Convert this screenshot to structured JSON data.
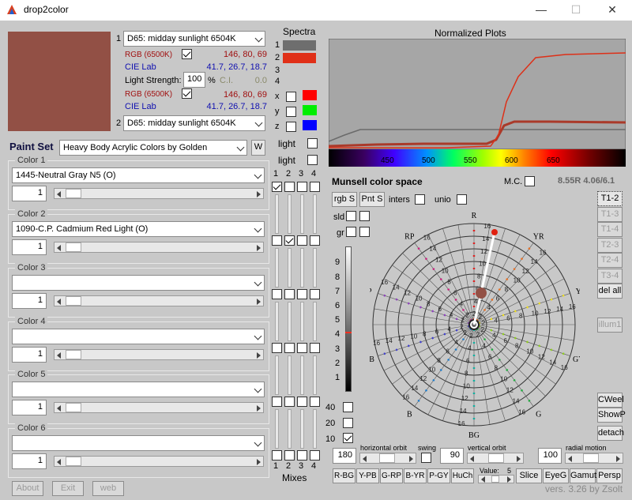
{
  "window": {
    "title": "drop2color"
  },
  "illum1": {
    "index": "1",
    "value": "D65: midday sunlight 6504K"
  },
  "illum2": {
    "index": "2",
    "value": "D65: midday sunlight 6504K"
  },
  "rgb1": {
    "label": "RGB (6500K)",
    "values": "146,   80,   69"
  },
  "lab1": {
    "label": "CIE Lab",
    "values": "41.7, 26.7, 18.7"
  },
  "light_strength": {
    "label": "Light Strength:",
    "value": "100",
    "unit": "%",
    "ci_label": "C.I.",
    "ci_value": "0.0"
  },
  "rgb2": {
    "label": "RGB (6500K)",
    "values": "146,   80,   69"
  },
  "lab2": {
    "label": "CIE Lab",
    "values": "41.7, 26.7, 18.7"
  },
  "swatch_color": "#925045",
  "paintset": {
    "label": "Paint Set",
    "value": "Heavy Body Acrylic Colors by Golden",
    "w_button": "W"
  },
  "colors": [
    {
      "label": "Color 1",
      "value": "1445-Neutral Gray N5 (O)",
      "qty": "1"
    },
    {
      "label": "Color 2",
      "value": "1090-C.P. Cadmium Red Light (O)",
      "qty": "1"
    },
    {
      "label": "Color 3",
      "value": "",
      "qty": "1"
    },
    {
      "label": "Color 4",
      "value": "",
      "qty": "1"
    },
    {
      "label": "Color 5",
      "value": "",
      "qty": "1"
    },
    {
      "label": "Color 6",
      "value": "",
      "qty": "1"
    }
  ],
  "mix_headers": [
    "1",
    "2",
    "3",
    "4"
  ],
  "mixes_label": "Mixes",
  "spectra": {
    "title": "Spectra",
    "rows": [
      "1",
      "2",
      "3",
      "4"
    ],
    "xyz": [
      "x",
      "y",
      "z"
    ],
    "light1": "light",
    "light2": "light",
    "row1_color": "#6e6e6e",
    "row2_color": "#e03018"
  },
  "plot": {
    "title": "Normalized Plots",
    "ticks": [
      "450",
      "500",
      "550",
      "600",
      "650"
    ]
  },
  "munsell": {
    "title": "Munsell color space",
    "mc_label": "M.C.",
    "readout": "8.55R 4.06/6.1",
    "rgbs": "rgb S",
    "pnts": "Pnt S",
    "inters": "inters",
    "unio": "unio",
    "sld": "sld",
    "gr": "gr",
    "dots": [
      "40",
      "20",
      "10"
    ],
    "hue_labels": [
      "R",
      "YR",
      "Y",
      "GY",
      "G",
      "BG",
      "B",
      "PB",
      "P",
      "RP"
    ],
    "ring_labels": [
      "2",
      "4",
      "6",
      "8",
      "10",
      "12",
      "14",
      "16"
    ],
    "value_ticks": [
      "1",
      "2",
      "3",
      "4",
      "5",
      "6",
      "7",
      "8",
      "9"
    ]
  },
  "t_buttons": [
    "T1-2",
    "T1-3",
    "T1-4",
    "T2-3",
    "T2-4",
    "T3-4",
    "del all"
  ],
  "illum1_btn": "illum1",
  "right_btns": [
    "CWeel",
    "ShowP",
    "detach"
  ],
  "orbits": {
    "h_value": "180",
    "h_label": "horizontal orbit",
    "swing": "swing",
    "v_value": "90",
    "v_label": "vertical orbit",
    "r_value": "100",
    "r_label": "radial motion"
  },
  "bottom_btns": [
    "R-BG",
    "Y-PB",
    "G-RP",
    "B-YR",
    "P-GY",
    "HuCh"
  ],
  "value_ctrl": {
    "label": "Value:",
    "value": "5"
  },
  "view_btns": [
    "Slice",
    "EyeG",
    "Gamut",
    "Persp"
  ],
  "footer": {
    "about": "About",
    "exit": "Exit",
    "web": "web",
    "version": "vers. 3.26 by Zsolt"
  }
}
